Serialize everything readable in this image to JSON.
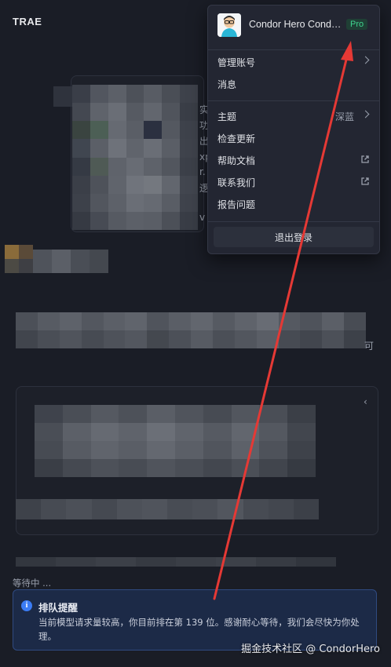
{
  "app": {
    "title": "TRAE"
  },
  "menu": {
    "user_name": "Condor Hero Condor Hero",
    "plan_badge": "Pro",
    "items": [
      {
        "label": "管理账号",
        "value": "",
        "trailing": "chevron"
      },
      {
        "label": "消息",
        "value": "",
        "trailing": "none"
      },
      {
        "label": "主题",
        "value": "深蓝",
        "trailing": "chevron"
      },
      {
        "label": "检查更新",
        "value": "",
        "trailing": "none"
      },
      {
        "label": "帮助文档",
        "value": "",
        "trailing": "external-link-icon"
      },
      {
        "label": "联系我们",
        "value": "",
        "trailing": "external-link-icon"
      },
      {
        "label": "报告问题",
        "value": "",
        "trailing": "none"
      }
    ],
    "logout_label": "退出登录"
  },
  "status": {
    "waiting_text": "等待中 ...",
    "queue_title": "排队提醒",
    "queue_message": "当前模型请求量较高，你目前排在第 139 位。感谢耐心等待，我们会尽快为你处理。"
  },
  "visible_fragments": [
    "实",
    "功",
    "出",
    "xp",
    "r.",
    "逻",
    "v",
    "可"
  ],
  "watermark": "掘金技术社区 @ CondorHero",
  "colors": {
    "accent": "#3b7cf5",
    "pro": "#3fd58f",
    "arrow": "#e53935",
    "background": "#1a1d26"
  }
}
